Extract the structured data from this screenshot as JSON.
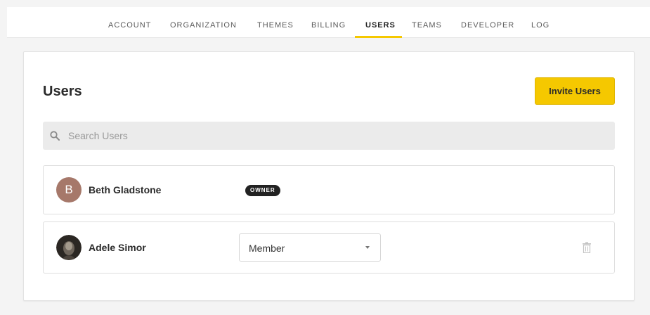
{
  "nav": {
    "items": [
      {
        "label": "ACCOUNT"
      },
      {
        "label": "ORGANIZATION"
      },
      {
        "label": "THEMES"
      },
      {
        "label": "BILLING"
      },
      {
        "label": "USERS"
      },
      {
        "label": "TEAMS"
      },
      {
        "label": "DEVELOPER"
      },
      {
        "label": "LOG"
      }
    ],
    "active": "USERS"
  },
  "page": {
    "title": "Users",
    "invite_label": "Invite Users",
    "search_placeholder": "Search Users"
  },
  "users": [
    {
      "name": "Beth Gladstone",
      "avatar_letter": "B",
      "avatar_color": "#a6786a",
      "role_badge": "OWNER"
    },
    {
      "name": "Adele Simor",
      "avatar_icon": "photo-avatar",
      "role": "Member"
    }
  ],
  "colors": {
    "accent": "#f5c800",
    "background": "#f4f4f4",
    "badge": "#222222"
  },
  "icons": {
    "search": "search-icon",
    "dropdown": "caret-down-icon",
    "delete": "trash-icon"
  }
}
